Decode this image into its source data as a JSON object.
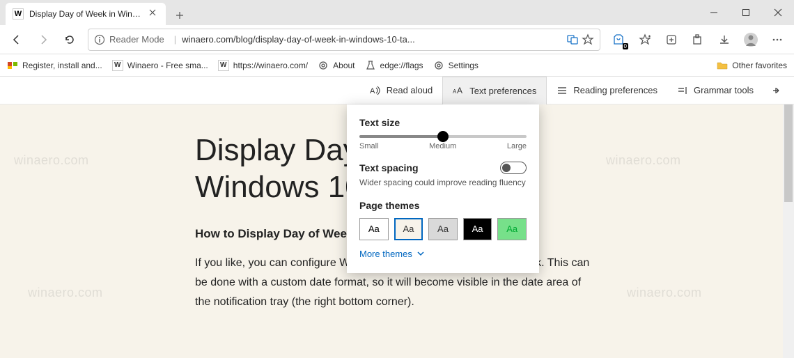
{
  "window": {
    "tab_title": "Display Day of Week in Windows",
    "favicon_letter": "W"
  },
  "addr": {
    "reader_mode": "Reader Mode",
    "url": "winaero.com/blog/display-day-of-week-in-windows-10-ta...",
    "collections_badge": "0"
  },
  "bookmarks": {
    "items": [
      "Register, install and...",
      "Winaero - Free sma...",
      "https://winaero.com/",
      "About",
      "edge://flags",
      "Settings"
    ],
    "other": "Other favorites"
  },
  "reader_toolbar": {
    "read_aloud": "Read aloud",
    "text_prefs": "Text preferences",
    "reading_prefs": "Reading preferences",
    "grammar": "Grammar tools"
  },
  "article": {
    "h1": "Display Day of Week in Windows 10 Taskbar",
    "h3": "How to Display Day of Week in Windows 10 Taskbar",
    "p": "If you like, you can configure Windows 10 to show the day of the week. This can be done with a custom date format, so it will become visible in the date area of the notification tray (the right bottom corner)."
  },
  "popover": {
    "text_size_label": "Text size",
    "slider": {
      "small": "Small",
      "medium": "Medium",
      "large": "Large"
    },
    "spacing_label": "Text spacing",
    "spacing_desc": "Wider spacing could improve reading fluency",
    "themes_label": "Page themes",
    "theme_sample": "Aa",
    "more": "More themes"
  },
  "watermark": "winaero.com"
}
